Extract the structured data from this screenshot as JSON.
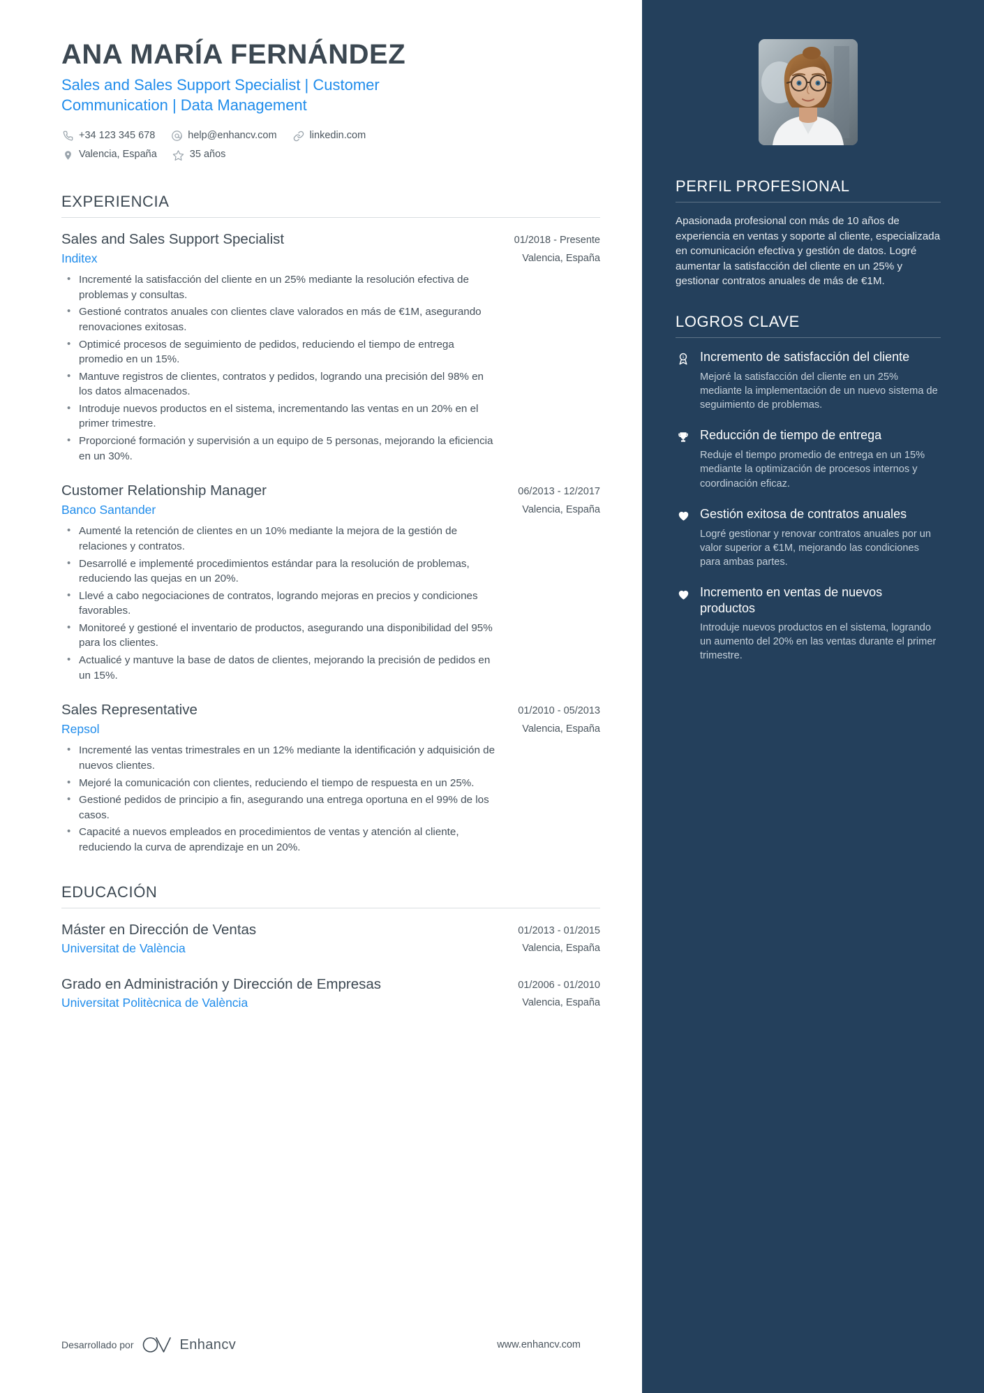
{
  "header": {
    "name": "ANA MARÍA FERNÁNDEZ",
    "headline": "Sales and Sales Support Specialist | Customer Communication | Data Management",
    "contacts": [
      {
        "icon": "phone-icon",
        "text": "+34 123 345 678"
      },
      {
        "icon": "email-icon",
        "text": "help@enhancv.com"
      },
      {
        "icon": "link-icon",
        "text": "linkedin.com"
      },
      {
        "icon": "location-pin-icon",
        "text": "Valencia, España"
      },
      {
        "icon": "star-icon",
        "text": "35 años"
      }
    ],
    "photo_alt": "portrait-photo"
  },
  "main": {
    "experience": {
      "title": "EXPERIENCIA",
      "entries": [
        {
          "role": "Sales and Sales Support Specialist",
          "date": "01/2018 - Presente",
          "company": "Inditex",
          "location": "Valencia, España",
          "bullets": [
            "Incrementé la satisfacción del cliente en un 25% mediante la resolución efectiva de problemas y consultas.",
            "Gestioné contratos anuales con clientes clave valorados en más de €1M, asegurando renovaciones exitosas.",
            "Optimicé procesos de seguimiento de pedidos, reduciendo el tiempo de entrega promedio en un 15%.",
            "Mantuve registros de clientes, contratos y pedidos, logrando una precisión del 98% en los datos almacenados.",
            "Introduje nuevos productos en el sistema, incrementando las ventas en un 20% en el primer trimestre.",
            "Proporcioné formación y supervisión a un equipo de 5 personas, mejorando la eficiencia en un 30%."
          ]
        },
        {
          "role": "Customer Relationship Manager",
          "date": "06/2013 - 12/2017",
          "company": "Banco Santander",
          "location": "Valencia, España",
          "bullets": [
            "Aumenté la retención de clientes en un 10% mediante la mejora de la gestión de relaciones y contratos.",
            "Desarrollé e implementé procedimientos estándar para la resolución de problemas, reduciendo las quejas en un 20%.",
            "Llevé a cabo negociaciones de contratos, logrando mejoras en precios y condiciones favorables.",
            "Monitoreé y gestioné el inventario de productos, asegurando una disponibilidad del 95% para los clientes.",
            "Actualicé y mantuve la base de datos de clientes, mejorando la precisión de pedidos en un 15%."
          ]
        },
        {
          "role": "Sales Representative",
          "date": "01/2010 - 05/2013",
          "company": "Repsol",
          "location": "Valencia, España",
          "bullets": [
            "Incrementé las ventas trimestrales en un 12% mediante la identificación y adquisición de nuevos clientes.",
            "Mejoré la comunicación con clientes, reduciendo el tiempo de respuesta en un 25%.",
            "Gestioné pedidos de principio a fin, asegurando una entrega oportuna en el 99% de los casos.",
            "Capacité a nuevos empleados en procedimientos de ventas y atención al cliente, reduciendo la curva de aprendizaje en un 20%."
          ]
        }
      ]
    },
    "education": {
      "title": "EDUCACIÓN",
      "entries": [
        {
          "degree": "Máster en Dirección de Ventas",
          "date": "01/2013 - 01/2015",
          "school": "Universitat de València",
          "location": "Valencia, España"
        },
        {
          "degree": "Grado en Administración y Dirección de Empresas",
          "date": "01/2006 - 01/2010",
          "school": "Universitat Politècnica de València",
          "location": "Valencia, España"
        }
      ]
    }
  },
  "sidebar": {
    "profile": {
      "title": "PERFIL PROFESIONAL",
      "text": "Apasionada profesional con más de 10 años de experiencia en ventas y soporte al cliente, especializada en comunicación efectiva y gestión de datos. Logré aumentar la satisfacción del cliente en un 25% y gestionar contratos anuales de más de €1M."
    },
    "achievements": {
      "title": "LOGROS CLAVE",
      "items": [
        {
          "icon": "award-ribbon-icon",
          "title": "Incremento de satisfacción del cliente",
          "desc": "Mejoré la satisfacción del cliente en un 25% mediante la implementación de un nuevo sistema de seguimiento de problemas."
        },
        {
          "icon": "trophy-icon",
          "title": "Reducción de tiempo de entrega",
          "desc": "Reduje el tiempo promedio de entrega en un 15% mediante la optimización de procesos internos y coordinación eficaz."
        },
        {
          "icon": "heart-icon",
          "title": "Gestión exitosa de contratos anuales",
          "desc": "Logré gestionar y renovar contratos anuales por un valor superior a €1M, mejorando las condiciones para ambas partes."
        },
        {
          "icon": "heart-icon",
          "title": "Incremento en ventas de nuevos productos",
          "desc": "Introduje nuevos productos en el sistema, logrando un aumento del 20% en las ventas durante el primer trimestre."
        }
      ]
    }
  },
  "footer": {
    "powered_by": "Desarrollado por",
    "brand": "Enhancv",
    "url": "www.enhancv.com"
  },
  "colors": {
    "sidebar_bg": "#24405c",
    "accent_blue": "#1f8ceb",
    "heading": "#3c4852",
    "body_text": "#45505a"
  }
}
